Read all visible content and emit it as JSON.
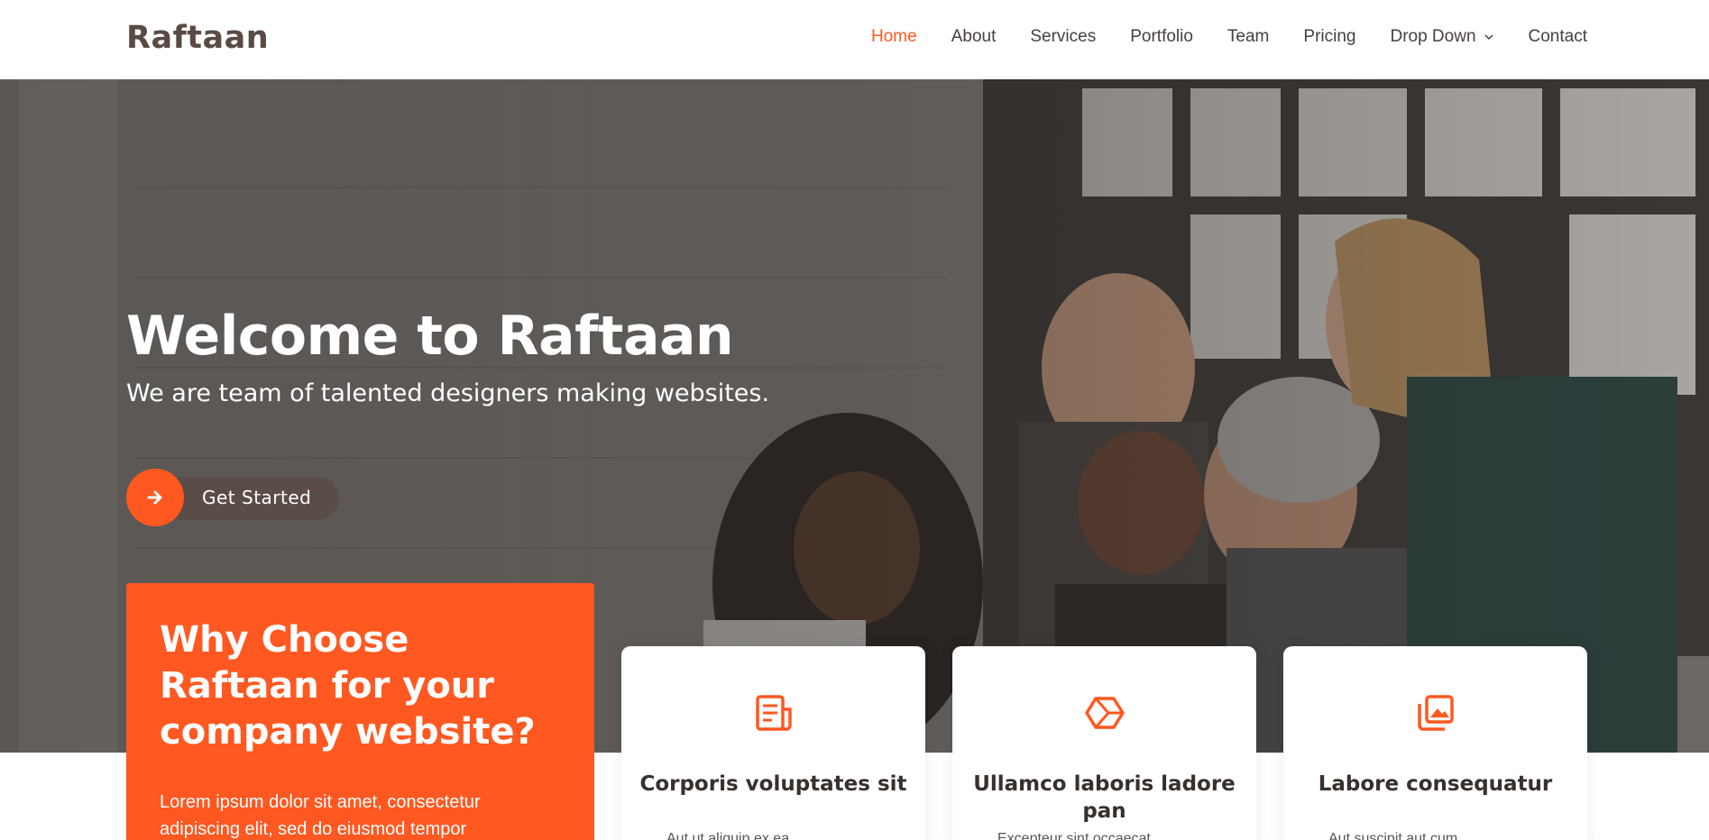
{
  "header": {
    "logo": "Raftaan",
    "nav": [
      {
        "label": "Home",
        "active": true
      },
      {
        "label": "About"
      },
      {
        "label": "Services"
      },
      {
        "label": "Portfolio"
      },
      {
        "label": "Team"
      },
      {
        "label": "Pricing"
      },
      {
        "label": "Drop Down",
        "has_dropdown": true
      },
      {
        "label": "Contact"
      }
    ]
  },
  "hero": {
    "title": "Welcome to Raftaan",
    "subtitle": "We are team of talented designers making websites.",
    "cta_label": "Get Started",
    "cta_icon": "arrow-right-icon"
  },
  "why": {
    "title": "Why Choose Raftaan for your company website?",
    "text": "Lorem ipsum dolor sit amet, consectetur adipiscing elit, sed do eiusmod tempor"
  },
  "cards": [
    {
      "icon": "receipt-icon",
      "title": "Corporis voluptates sit",
      "text": "Aut ut aliquip ex ea"
    },
    {
      "icon": "cube-icon",
      "title": "Ullamco laboris ladore pan",
      "text": "Excepteur sint occaecat"
    },
    {
      "icon": "images-icon",
      "title": "Labore consequatur",
      "text": "Aut suscipit aut cum"
    }
  ],
  "colors": {
    "accent": "#ff5821",
    "brown": "#5a4a44",
    "white": "#ffffff"
  }
}
